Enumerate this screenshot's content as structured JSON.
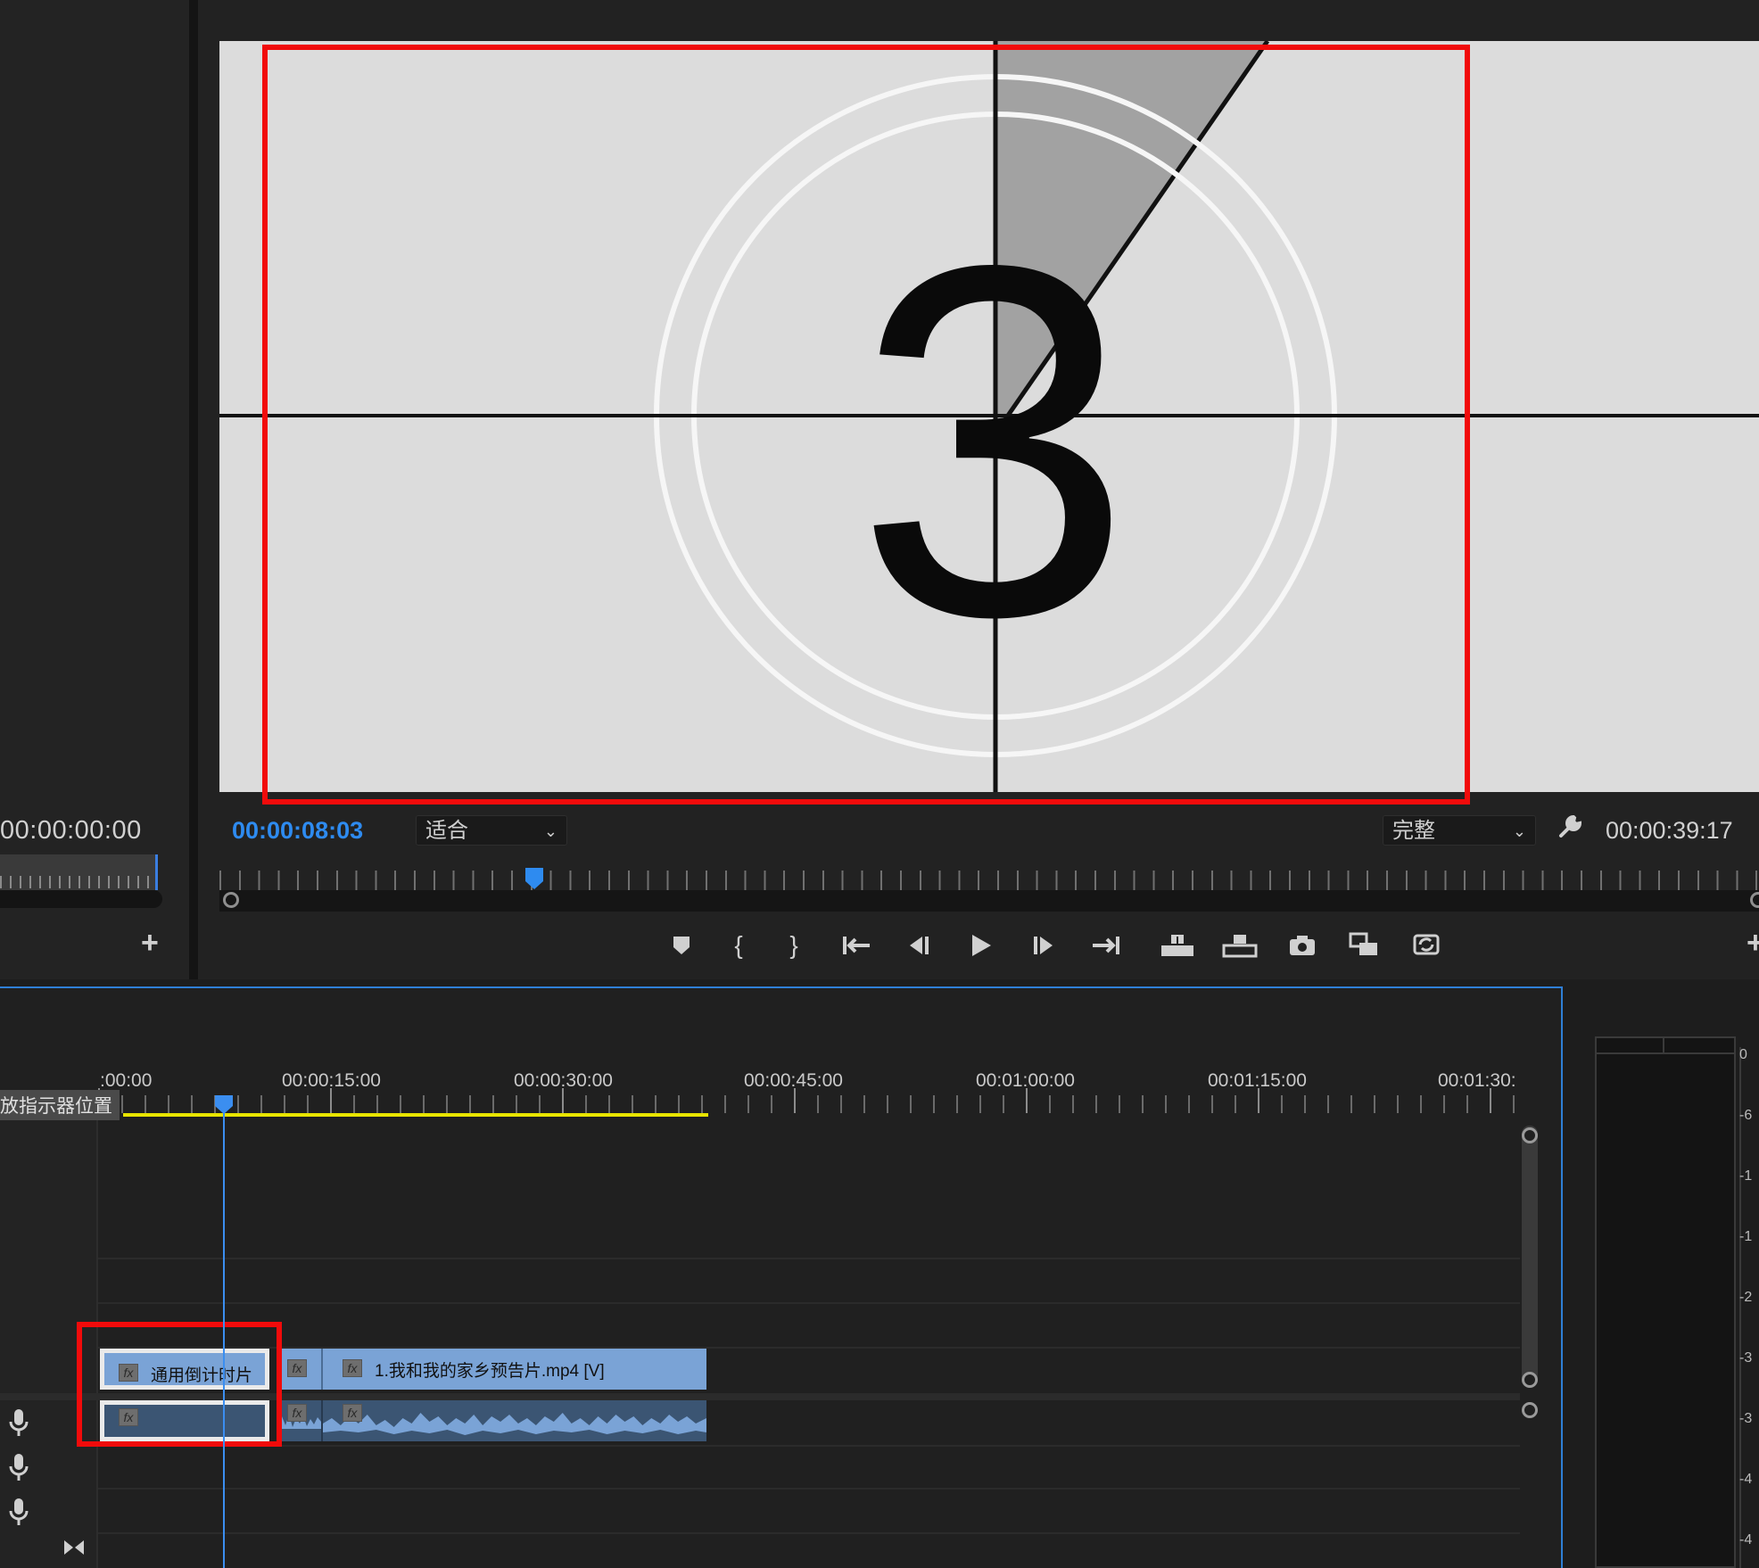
{
  "source_monitor": {
    "timecode": "00:00:00:00",
    "add_button": "+"
  },
  "program_monitor": {
    "current_timecode": "00:00:08:03",
    "zoom": {
      "selected": "适合"
    },
    "quality": {
      "selected": "完整"
    },
    "duration_timecode": "00:00:39:17",
    "frame_number": "3",
    "add_button": "+",
    "transport_buttons": [
      "add-marker",
      "mark-in",
      "mark-out",
      "go-to-in",
      "step-back",
      "play",
      "step-forward",
      "go-to-out",
      "lift",
      "extract",
      "export-frame",
      "insert",
      "overwrite"
    ]
  },
  "timeline": {
    "ruler_labels": [
      ":00:00",
      "00:00:15:00",
      "00:00:30:00",
      "00:00:45:00",
      "00:01:00:00",
      "00:01:15:00",
      "00:01:30:"
    ],
    "tooltip": "放指示器位置",
    "clips": {
      "countdown_video": {
        "fx": "fx",
        "label": "通用倒计时片"
      },
      "transition_video": {
        "fx": "fx"
      },
      "main_video": {
        "fx": "fx",
        "label": "1.我和我的家乡预告片.mp4 [V]"
      },
      "countdown_audio": {
        "fx": "fx"
      },
      "transition_audio": {
        "fx": "fx"
      },
      "main_audio": {
        "fx": "fx"
      }
    }
  },
  "audio_meter": {
    "scale": [
      "0",
      "-6",
      "-1",
      "-1",
      "-2",
      "-3",
      "-3",
      "-4",
      "-4"
    ]
  },
  "colors": {
    "accent_blue": "#2e8bf0",
    "highlight_red": "#f10b0b",
    "clip_blue": "#7aa3d6",
    "work_area_yellow": "#e8e400"
  }
}
